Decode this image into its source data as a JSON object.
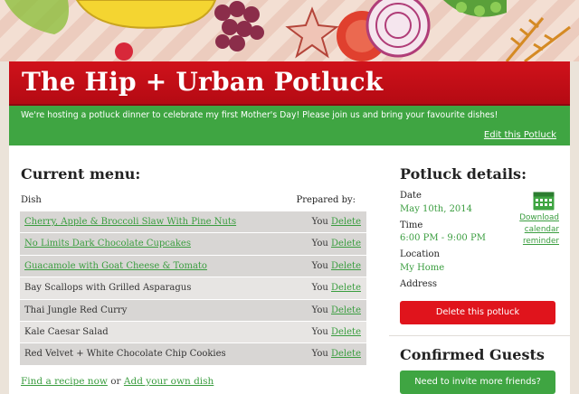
{
  "header": {
    "title": "The Hip + Urban Potluck",
    "intro": "We're hosting a potluck dinner to celebrate my first Mother's Day! Please join us and bring your favourite dishes!",
    "edit_link": "Edit this Potluck"
  },
  "menu": {
    "heading": "Current menu:",
    "col_dish": "Dish",
    "col_prepared": "Prepared by:",
    "items": [
      {
        "dish": "Cherry, Apple & Broccoli Slaw With Pine Nuts",
        "link": true,
        "by": "You",
        "delete": "Delete"
      },
      {
        "dish": "No Limits Dark Chocolate Cupcakes",
        "link": true,
        "by": "You",
        "delete": "Delete"
      },
      {
        "dish": "Guacamole with Goat Cheese & Tomato",
        "link": true,
        "by": "You",
        "delete": "Delete"
      },
      {
        "dish": "Bay Scallops with Grilled Asparagus",
        "link": false,
        "by": "You",
        "delete": "Delete"
      },
      {
        "dish": "Thai Jungle Red Curry",
        "link": false,
        "by": "You",
        "delete": "Delete"
      },
      {
        "dish": "Kale Caesar Salad",
        "link": false,
        "by": "You",
        "delete": "Delete"
      },
      {
        "dish": "Red Velvet + White Chocolate Chip Cookies",
        "link": false,
        "by": "You",
        "delete": "Delete"
      }
    ],
    "find_recipe": "Find a recipe now",
    "or": "or",
    "add_own": "Add your own dish"
  },
  "details": {
    "heading": "Potluck details:",
    "date_label": "Date",
    "date_value": "May 10th, 2014",
    "time_label": "Time",
    "time_value": "6:00 PM - 9:00 PM",
    "location_label": "Location",
    "location_value": "My Home",
    "address_label": "Address",
    "calendar_l1": "Download",
    "calendar_l2": "calendar",
    "calendar_l3": "reminder",
    "delete_button": "Delete this potluck"
  },
  "guests": {
    "heading": "Confirmed Guests",
    "invite_button": "Need to invite more friends?"
  },
  "colors": {
    "red": "#d0121b",
    "green": "#3fa542",
    "link_green": "#3a9d3f"
  }
}
